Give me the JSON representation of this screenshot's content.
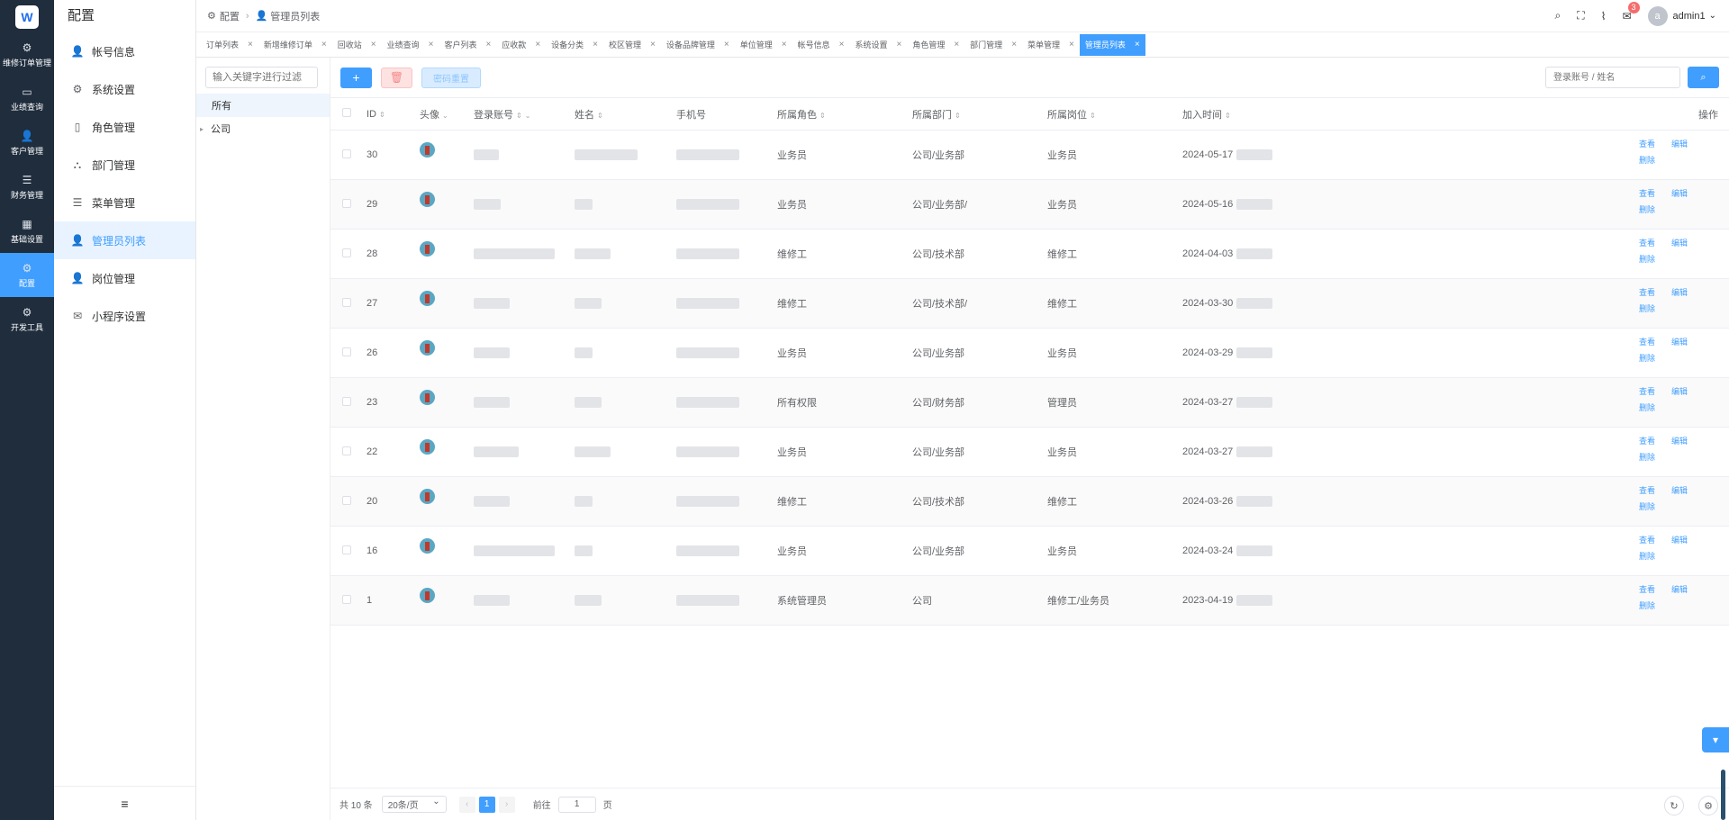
{
  "rail": {
    "logo": "W",
    "items": [
      {
        "icon": "cpu-icon",
        "glyph": "⚙",
        "label": "维修订单管理"
      },
      {
        "icon": "monitor-icon",
        "glyph": "▭",
        "label": "业绩查询"
      },
      {
        "icon": "user-icon",
        "glyph": "👤",
        "label": "客户管理"
      },
      {
        "icon": "database-icon",
        "glyph": "☰",
        "label": "财务管理"
      },
      {
        "icon": "grid-icon",
        "glyph": "▦",
        "label": "基础设置"
      },
      {
        "icon": "gear-icon",
        "glyph": "⚙",
        "label": "配置"
      },
      {
        "icon": "tools-icon",
        "glyph": "⚙",
        "label": "开发工具"
      }
    ]
  },
  "sidebar": {
    "title": "配置",
    "items": [
      {
        "icon": "user-icon",
        "glyph": "👤",
        "label": "帐号信息"
      },
      {
        "icon": "gear-icon",
        "glyph": "⚙",
        "label": "系统设置"
      },
      {
        "icon": "document-icon",
        "glyph": "▯",
        "label": "角色管理"
      },
      {
        "icon": "org-icon",
        "glyph": "⛬",
        "label": "部门管理"
      },
      {
        "icon": "list-icon",
        "glyph": "☰",
        "label": "菜单管理"
      },
      {
        "icon": "user-icon",
        "glyph": "👤",
        "label": "管理员列表"
      },
      {
        "icon": "user-icon",
        "glyph": "👤",
        "label": "岗位管理"
      },
      {
        "icon": "wechat-icon",
        "glyph": "✉",
        "label": "小程序设置"
      }
    ],
    "fold_glyph": "≡"
  },
  "breadcrumb": [
    "配置",
    "管理员列表"
  ],
  "header": {
    "notification_count": "3",
    "avatar_letter": "a",
    "username": "admin1"
  },
  "tabs": [
    "订单列表",
    "新增维修订单",
    "回收站",
    "业绩查询",
    "客户列表",
    "应收款",
    "设备分类",
    "校区管理",
    "设备品牌管理",
    "单位管理",
    "帐号信息",
    "系统设置",
    "角色管理",
    "部门管理",
    "菜单管理",
    "管理员列表"
  ],
  "tree": {
    "placeholder": "输入关键字进行过滤",
    "nodes": [
      "所有",
      "公司"
    ]
  },
  "toolbar": {
    "add": "+",
    "delete": "🗑",
    "reset_pw": "密码重置",
    "search_placeholder": "登录账号 / 姓名",
    "search_btn": "⌕"
  },
  "table": {
    "headers": [
      "ID",
      "头像",
      "登录账号",
      "姓名",
      "手机号",
      "所属角色",
      "所属部门",
      "所属岗位",
      "加入时间",
      "操作"
    ],
    "rows": [
      {
        "id": "30",
        "role": "业务员",
        "dept": "公司/业务部",
        "post": "业务员",
        "date": "2024-05-17"
      },
      {
        "id": "29",
        "role": "业务员",
        "dept": "公司/业务部/",
        "post": "业务员",
        "date": "2024-05-16"
      },
      {
        "id": "28",
        "role": "维修工",
        "dept": "公司/技术部",
        "post": "维修工",
        "date": "2024-04-03"
      },
      {
        "id": "27",
        "role": "维修工",
        "dept": "公司/技术部/",
        "post": "维修工",
        "date": "2024-03-30"
      },
      {
        "id": "26",
        "role": "业务员",
        "dept": "公司/业务部",
        "post": "业务员",
        "date": "2024-03-29"
      },
      {
        "id": "23",
        "role": "所有权限",
        "dept": "公司/财务部",
        "post": "管理员",
        "date": "2024-03-27"
      },
      {
        "id": "22",
        "role": "业务员",
        "dept": "公司/业务部",
        "post": "业务员",
        "date": "2024-03-27"
      },
      {
        "id": "20",
        "role": "维修工",
        "dept": "公司/技术部",
        "post": "维修工",
        "date": "2024-03-26"
      },
      {
        "id": "16",
        "role": "业务员",
        "dept": "公司/业务部",
        "post": "业务员",
        "date": "2024-03-24"
      },
      {
        "id": "1",
        "role": "系统管理员",
        "dept": "公司",
        "post": "维修工/业务员",
        "date": "2023-04-19"
      }
    ],
    "ops": {
      "view": "查看",
      "edit": "编辑",
      "delete": "删除"
    }
  },
  "pagination": {
    "total": "共 10 条",
    "page_size": "20条/页",
    "current": "1",
    "goto": "前往",
    "goto_value": "1",
    "page_unit": "页"
  }
}
